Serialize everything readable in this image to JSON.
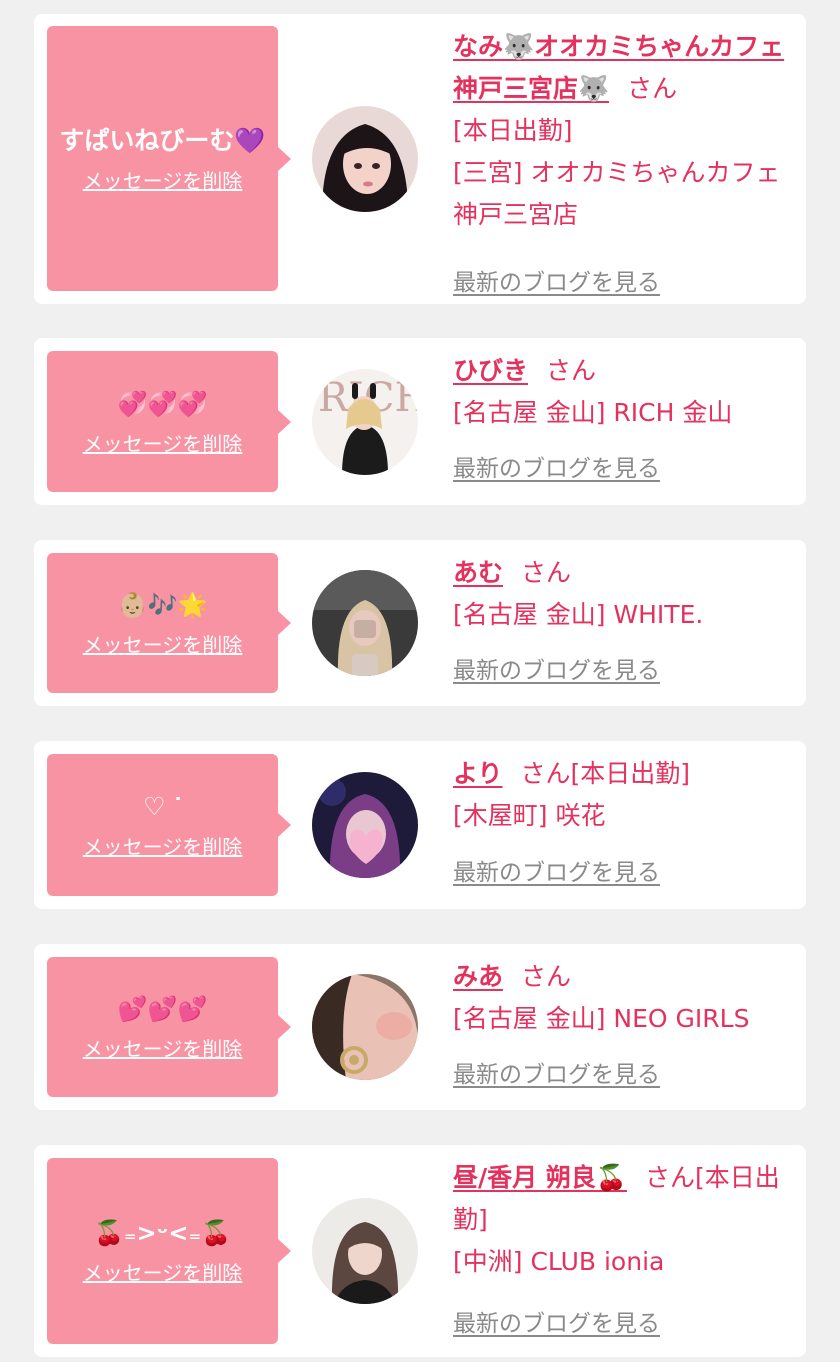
{
  "delete_label": "メッセージを削除",
  "blog_label": "最新のブログを見る",
  "san_label": "さん",
  "colors": {
    "background": "#f0f0f0",
    "card": "#ffffff",
    "bubble": "#f893a4",
    "accent": "#e4325e",
    "link_gray": "#8a8a8a"
  },
  "cards": [
    {
      "message": "すぱいねびーむ💜",
      "name": "なみ🐺オオカミちゃんカフェ神戸三宮店🐺",
      "attendance": "[本日出勤]",
      "shop": "[三宮] オオカミちゃんカフェ神戸三宮店"
    },
    {
      "message": "💞💞💞",
      "name": "ひびき",
      "attendance": "",
      "shop": "[名古屋 金山] RICH 金山"
    },
    {
      "message": "👶🏼🎶🌟",
      "name": "あむ",
      "attendance": "",
      "shop": "[名古屋 金山] WHITE."
    },
    {
      "message": "♡ ᐝ",
      "name": "より",
      "attendance": "[本日出勤]",
      "shop": "[木屋町] 咲花"
    },
    {
      "message": "💕💕💕",
      "name": "みあ",
      "attendance": "",
      "shop": "[名古屋 金山] NEO GIRLS"
    },
    {
      "message": "🍒₌>ᵕ<₌🍒",
      "name": "昼/香月 朔良🍒",
      "attendance": "[本日出勤]",
      "shop": "[中洲] CLUB ionia"
    }
  ]
}
